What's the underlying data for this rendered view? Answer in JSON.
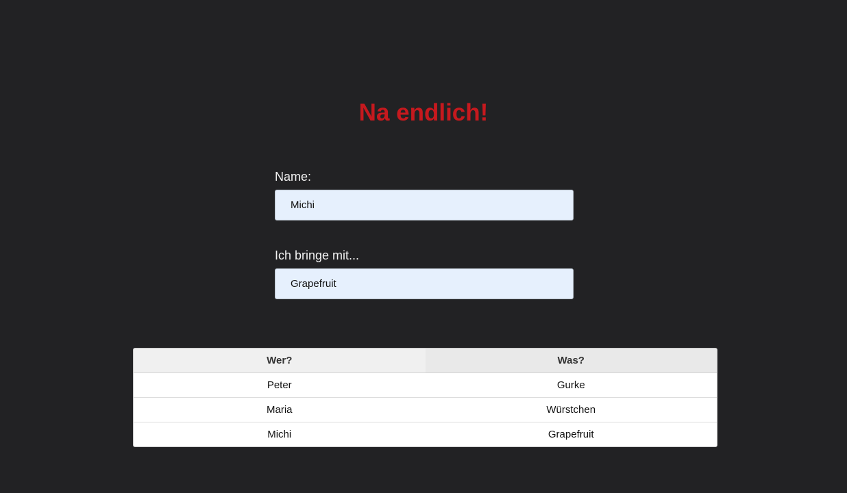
{
  "title": "Na endlich!",
  "form": {
    "name_label": "Name:",
    "name_value": "Michi",
    "item_label": "Ich bringe mit...",
    "item_value": "Grapefruit"
  },
  "table": {
    "headers": [
      "Wer?",
      "Was?"
    ],
    "rows": [
      [
        "Peter",
        "Gurke"
      ],
      [
        "Maria",
        "Würstchen"
      ],
      [
        "Michi",
        "Grapefruit"
      ]
    ]
  },
  "colors": {
    "background": "#222224",
    "title": "#c6191e",
    "input_background": "#e6f0fd"
  }
}
